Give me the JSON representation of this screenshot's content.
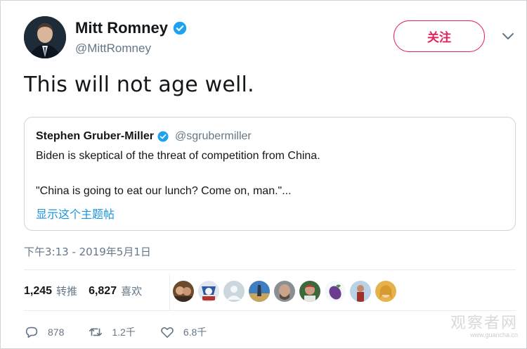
{
  "author": {
    "name": "Mitt Romney",
    "handle": "@MittRomney"
  },
  "follow_button_label": "关注",
  "tweet_text": "This will not age well.",
  "quoted_tweet": {
    "name": "Stephen Gruber-Miller",
    "handle": "@sgrubermiller",
    "line1": "Biden is skeptical of the threat of competition from China.",
    "line2": "\"China is going to eat our lunch? Come on, man.\"...",
    "show_thread_label": "显示这个主题帖"
  },
  "timestamp": "下午3:13 - 2019年5月1日",
  "stats": {
    "retweets_count": "1,245",
    "retweets_label": "转推",
    "likes_count": "6,827",
    "likes_label": "喜欢"
  },
  "actions": {
    "reply_count": "878",
    "retweet_count": "1.2千",
    "like_count": "6.8千"
  },
  "watermark": {
    "text": "观察者网",
    "sub": "www.guancha.cn"
  },
  "colors": {
    "accent_red": "#e0245e",
    "link_blue": "#1b95e0",
    "verified_blue": "#1da1f2",
    "muted_gray": "#657786"
  }
}
